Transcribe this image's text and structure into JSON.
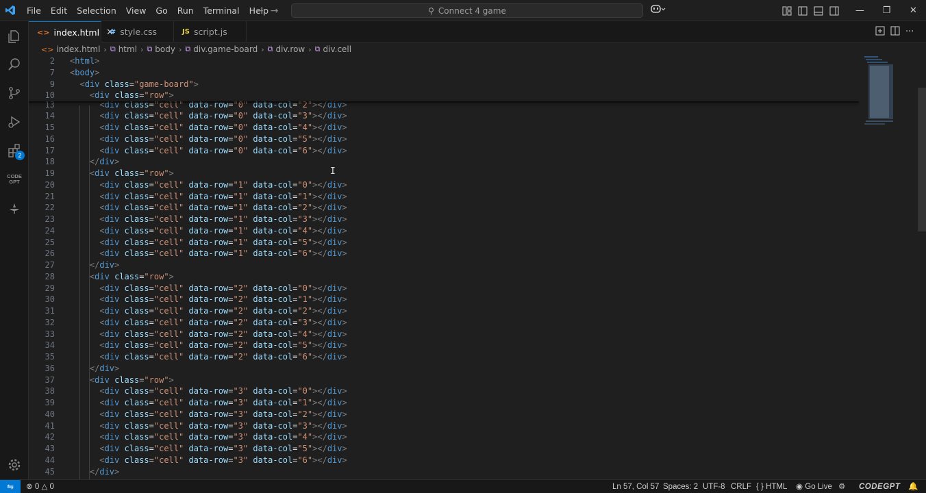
{
  "titlebar": {
    "menu": [
      "File",
      "Edit",
      "Selection",
      "View",
      "Go",
      "Run",
      "Terminal",
      "Help"
    ],
    "command_center": "Connect 4 game",
    "icons": [
      "vscode-logo",
      "back-arrow",
      "forward-arrow",
      "copilot-icon",
      "customize-layout",
      "toggle-primary-sidebar",
      "toggle-panel",
      "toggle-secondary-sidebar",
      "minimize",
      "restore",
      "close"
    ]
  },
  "activity_bar": {
    "items": [
      "explorer",
      "search",
      "source-control",
      "run-debug",
      "extensions",
      "codegpt",
      "ai-assistant",
      "manage"
    ],
    "extensions_badge": "2",
    "codegpt_label": [
      "CODE",
      "GPT"
    ]
  },
  "tabs": [
    {
      "label": "index.html",
      "icon": "<>",
      "active": true
    },
    {
      "label": "style.css",
      "icon": "#",
      "active": false
    },
    {
      "label": "script.js",
      "icon": "JS",
      "active": false
    }
  ],
  "breadcrumb": [
    "index.html",
    "html",
    "body",
    "div.game-board",
    "div.row",
    "div.cell"
  ],
  "editor": {
    "sticky_lines": [
      {
        "num": "2",
        "indent": "",
        "html": "html"
      },
      {
        "num": "7",
        "indent": "",
        "html": "body"
      },
      {
        "num": "9",
        "indent": "  ",
        "cls": "game-board"
      },
      {
        "num": "10",
        "indent": "    ",
        "cls": "row"
      }
    ],
    "lines": [
      {
        "num": "13",
        "type": "cell",
        "row": "0",
        "col": "2"
      },
      {
        "num": "14",
        "type": "cell",
        "row": "0",
        "col": "3"
      },
      {
        "num": "15",
        "type": "cell",
        "row": "0",
        "col": "4"
      },
      {
        "num": "16",
        "type": "cell",
        "row": "0",
        "col": "5"
      },
      {
        "num": "17",
        "type": "cell",
        "row": "0",
        "col": "6"
      },
      {
        "num": "18",
        "type": "close"
      },
      {
        "num": "19",
        "type": "open"
      },
      {
        "num": "20",
        "type": "cell",
        "row": "1",
        "col": "0"
      },
      {
        "num": "21",
        "type": "cell",
        "row": "1",
        "col": "1"
      },
      {
        "num": "22",
        "type": "cell",
        "row": "1",
        "col": "2"
      },
      {
        "num": "23",
        "type": "cell",
        "row": "1",
        "col": "3"
      },
      {
        "num": "24",
        "type": "cell",
        "row": "1",
        "col": "4"
      },
      {
        "num": "25",
        "type": "cell",
        "row": "1",
        "col": "5"
      },
      {
        "num": "26",
        "type": "cell",
        "row": "1",
        "col": "6"
      },
      {
        "num": "27",
        "type": "close"
      },
      {
        "num": "28",
        "type": "open"
      },
      {
        "num": "29",
        "type": "cell",
        "row": "2",
        "col": "0"
      },
      {
        "num": "30",
        "type": "cell",
        "row": "2",
        "col": "1"
      },
      {
        "num": "31",
        "type": "cell",
        "row": "2",
        "col": "2"
      },
      {
        "num": "32",
        "type": "cell",
        "row": "2",
        "col": "3"
      },
      {
        "num": "33",
        "type": "cell",
        "row": "2",
        "col": "4"
      },
      {
        "num": "34",
        "type": "cell",
        "row": "2",
        "col": "5"
      },
      {
        "num": "35",
        "type": "cell",
        "row": "2",
        "col": "6"
      },
      {
        "num": "36",
        "type": "close"
      },
      {
        "num": "37",
        "type": "open"
      },
      {
        "num": "38",
        "type": "cell",
        "row": "3",
        "col": "0"
      },
      {
        "num": "39",
        "type": "cell",
        "row": "3",
        "col": "1"
      },
      {
        "num": "40",
        "type": "cell",
        "row": "3",
        "col": "2"
      },
      {
        "num": "41",
        "type": "cell",
        "row": "3",
        "col": "3"
      },
      {
        "num": "42",
        "type": "cell",
        "row": "3",
        "col": "4"
      },
      {
        "num": "43",
        "type": "cell",
        "row": "3",
        "col": "5"
      },
      {
        "num": "44",
        "type": "cell",
        "row": "3",
        "col": "6"
      },
      {
        "num": "45",
        "type": "close"
      }
    ],
    "colors": {
      "tag": "#569cd6",
      "attr": "#9cdcfe",
      "value": "#ce9178",
      "punct": "#808080",
      "text": "#d4d4d4"
    }
  },
  "statusbar": {
    "errors": "0",
    "warnings": "0",
    "position": "Ln 57, Col 57",
    "spaces": "Spaces: 2",
    "encoding": "UTF-8",
    "eol": "CRLF",
    "language": "HTML",
    "go_live": "Go Live",
    "codegpt": "CODEGPT",
    "accent": "#0078d4"
  }
}
